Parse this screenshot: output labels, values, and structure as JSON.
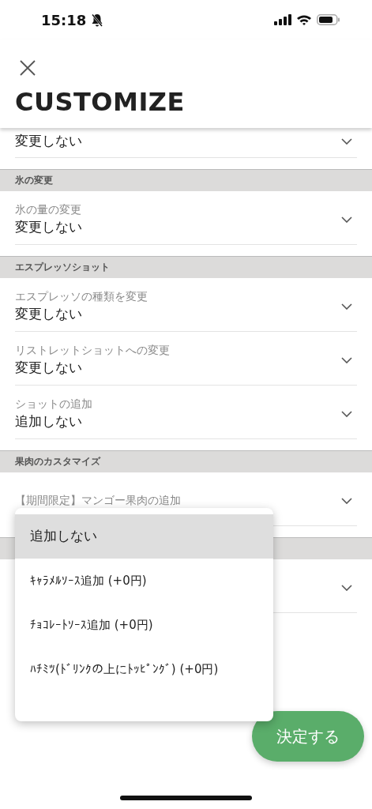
{
  "status_bar": {
    "time": "15:18"
  },
  "header": {
    "title": "CUSTOMIZE"
  },
  "items": [
    {
      "kind": "field",
      "value": "変更しない"
    },
    {
      "kind": "section",
      "title": "氷の変更"
    },
    {
      "kind": "field",
      "label": "氷の量の変更",
      "value": "変更しない"
    },
    {
      "kind": "section",
      "title": "エスプレッソショット"
    },
    {
      "kind": "field",
      "label": "エスプレッソの種類を変更",
      "value": "変更しない"
    },
    {
      "kind": "field",
      "label": "リストレットショットへの変更",
      "value": "変更しない"
    },
    {
      "kind": "field",
      "label": "ショットの追加",
      "value": "追加しない"
    },
    {
      "kind": "section",
      "title": "果肉のカスタマイズ"
    },
    {
      "kind": "field",
      "label": "【期間限定】マンゴー果肉の追加"
    },
    {
      "kind": "section"
    },
    {
      "kind": "field"
    }
  ],
  "dropdown": {
    "options": [
      {
        "label": "追加しない",
        "selected": true
      },
      {
        "label": "ｷｬﾗﾒﾙｿｰｽ追加 (+0円)",
        "selected": false
      },
      {
        "label": "ﾁｮｺﾚｰﾄｿｰｽ追加 (+0円)",
        "selected": false
      },
      {
        "label": "ﾊﾁﾐﾂ(ﾄﾞﾘﾝｸの上にﾄｯﾋﾟﾝｸﾞ) (+0円)",
        "selected": false
      }
    ]
  },
  "submit_button": {
    "label": "決定する"
  }
}
